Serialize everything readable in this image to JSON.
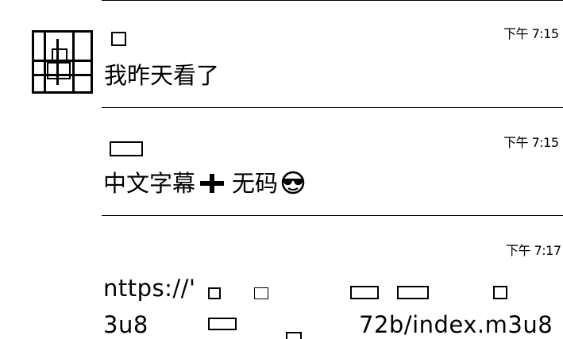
{
  "messages": [
    {
      "time": "下午 7:15",
      "text": "我昨天看了"
    },
    {
      "time": "下午 7:15",
      "text_a": "中文字幕",
      "text_b": "无码"
    },
    {
      "time": "下午 7:17",
      "url_line1": "nttps://'",
      "url_line2_a": "3u8",
      "url_line2_b": "72b/index.m3u8"
    }
  ],
  "icons": [
    "avatar-icon",
    "plus-icon",
    "sunglasses-smiley-icon"
  ]
}
